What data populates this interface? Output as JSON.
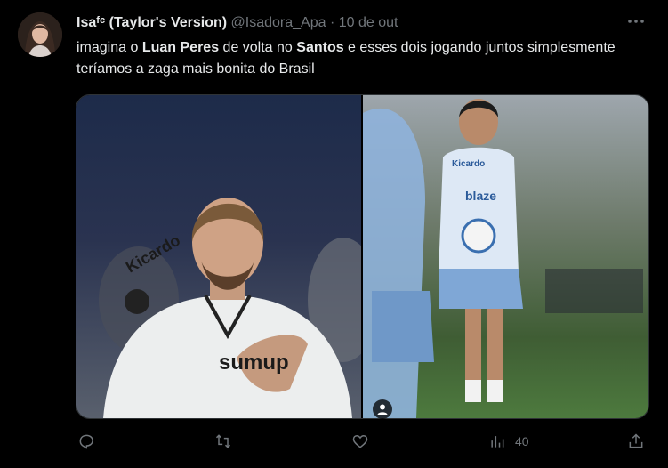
{
  "author": {
    "name": "Isaᶠᶜ (Taylor's Version)",
    "handle": "@Isadora_Apa",
    "separator": "·",
    "time": "10 de out"
  },
  "tweet": {
    "parts": [
      "imagina o ",
      "Luan Peres",
      " de volta no ",
      "Santos",
      " e esses dois jogando juntos simplesmente teríamos a zaga mais bonita do Brasil"
    ]
  },
  "media": {
    "left_photo": {
      "jersey_text": "sumup",
      "sponsor_text": "Kicardo"
    },
    "right_photo": {
      "jersey_text": "blaze",
      "sponsor_text": "Kicardo"
    }
  },
  "actions": {
    "views": "40"
  },
  "icons": [
    "more-icon",
    "reply-icon",
    "retweet-icon",
    "like-icon",
    "views-icon",
    "share-icon",
    "user-tag-icon"
  ],
  "colors": {
    "background": "#000000",
    "text": "#e7e9ea",
    "muted": "#71767b",
    "border": "#2f3336"
  }
}
